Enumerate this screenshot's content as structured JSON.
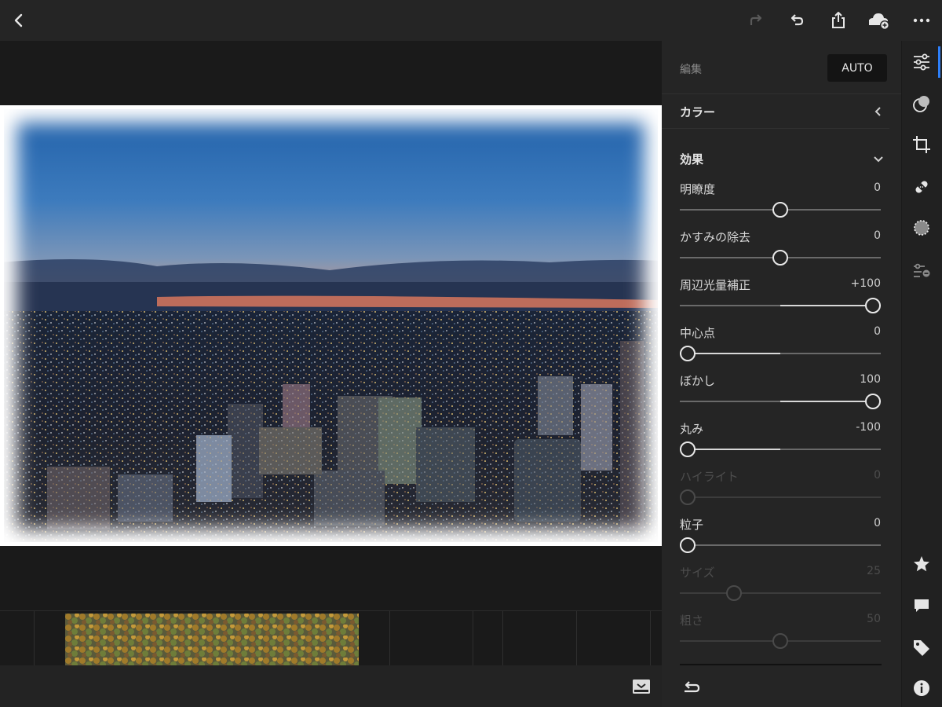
{
  "panel": {
    "edit_label": "編集",
    "auto_label": "AUTO",
    "sections": {
      "color": {
        "title": "カラー",
        "expanded": false
      },
      "effects": {
        "title": "効果",
        "expanded": true
      }
    },
    "sliders": [
      {
        "label": "明瞭度",
        "value_text": "0",
        "value": 0,
        "min": -100,
        "max": 100,
        "center": 0,
        "enabled": true
      },
      {
        "label": "かすみの除去",
        "value_text": "0",
        "value": 0,
        "min": -100,
        "max": 100,
        "center": 0,
        "enabled": true
      },
      {
        "label": "周辺光量補正",
        "value_text": "+100",
        "value": 100,
        "min": -100,
        "max": 100,
        "center": 0,
        "enabled": true
      },
      {
        "label": "中心点",
        "value_text": "0",
        "value": 0,
        "min": 0,
        "max": 100,
        "center": 50,
        "enabled": true
      },
      {
        "label": "ぼかし",
        "value_text": "100",
        "value": 100,
        "min": 0,
        "max": 100,
        "center": 50,
        "enabled": true
      },
      {
        "label": "丸み",
        "value_text": "-100",
        "value": -100,
        "min": -100,
        "max": 100,
        "center": 0,
        "enabled": true
      },
      {
        "label": "ハイライト",
        "value_text": "0",
        "value": 0,
        "min": 0,
        "max": 100,
        "center": 0,
        "enabled": false
      },
      {
        "label": "粒子",
        "value_text": "0",
        "value": 0,
        "min": 0,
        "max": 100,
        "center": 0,
        "enabled": true
      },
      {
        "label": "サイズ",
        "value_text": "25",
        "value": 25,
        "min": 0,
        "max": 100,
        "center": 0,
        "enabled": false
      },
      {
        "label": "粗さ",
        "value_text": "50",
        "value": 50,
        "min": 0,
        "max": 100,
        "center": 0,
        "enabled": false
      }
    ]
  },
  "toolbar": {
    "icons": [
      "back-icon",
      "redo-icon",
      "undo-icon",
      "share-icon",
      "cloud-add-icon",
      "more-icon"
    ]
  },
  "rail": {
    "icons": [
      "edit-sliders-icon",
      "selective-icon",
      "crop-icon",
      "healing-icon",
      "masking-icon",
      "presets-icon",
      "star-icon",
      "comment-icon",
      "tag-icon",
      "info-icon"
    ],
    "active": "edit-sliders-icon"
  },
  "colors": {
    "accent": "#2d7ff9",
    "panel_bg": "#252525",
    "canvas_bg": "#1a1a1a"
  }
}
